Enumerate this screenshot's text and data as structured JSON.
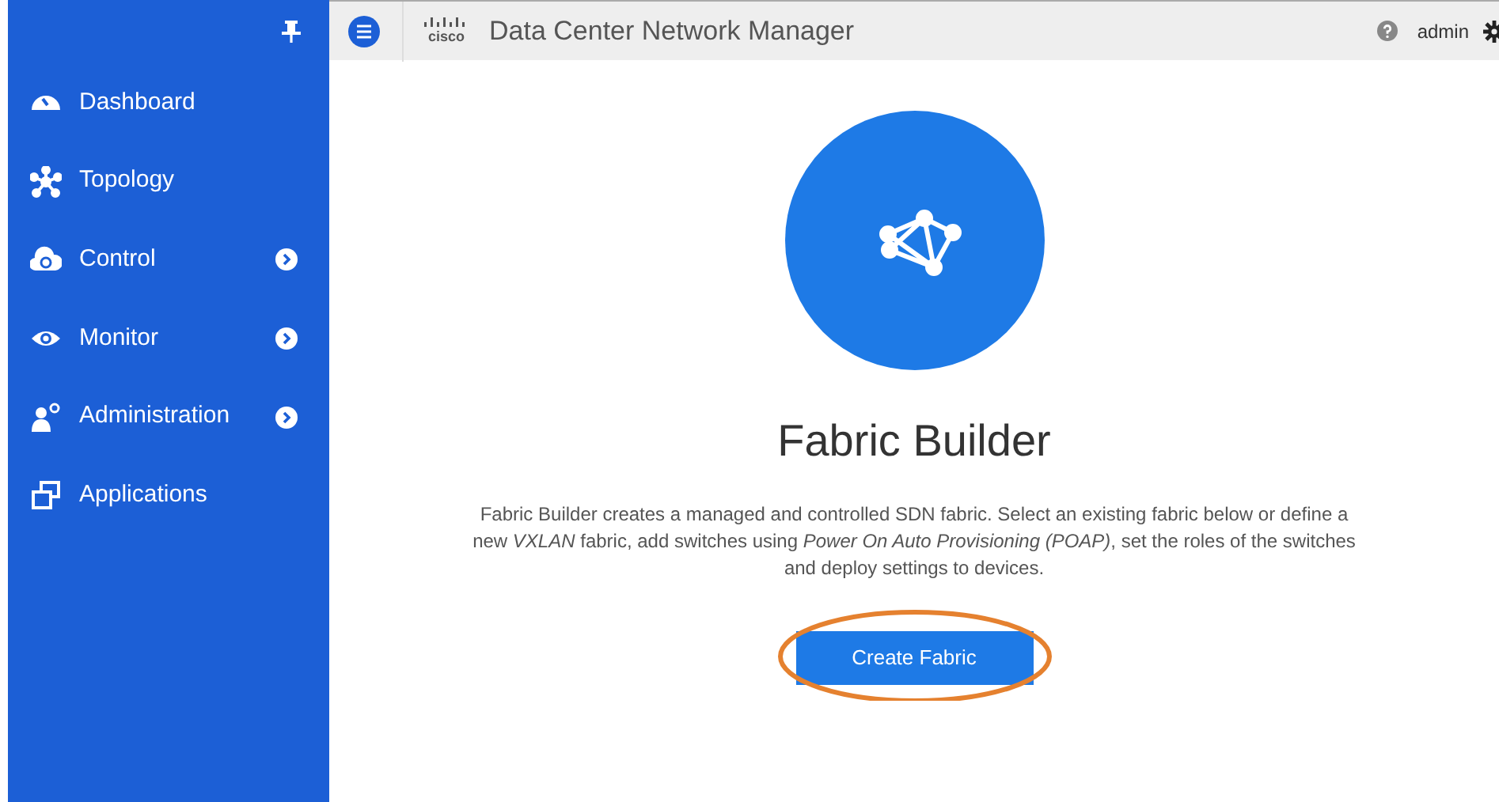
{
  "header": {
    "logo_text": "cisco",
    "title": "Data Center Network Manager",
    "user": "admin"
  },
  "sidebar": {
    "items": [
      {
        "kind": "dashboard",
        "label": "Dashboard",
        "has_submenu": false
      },
      {
        "kind": "topology",
        "label": "Topology",
        "has_submenu": false
      },
      {
        "kind": "control",
        "label": "Control",
        "has_submenu": true
      },
      {
        "kind": "monitor",
        "label": "Monitor",
        "has_submenu": true
      },
      {
        "kind": "administration",
        "label": "Administration",
        "has_submenu": true
      },
      {
        "kind": "applications",
        "label": "Applications",
        "has_submenu": false
      }
    ]
  },
  "main": {
    "title": "Fabric Builder",
    "description": "Fabric Builder creates a managed and controlled SDN fabric. Select an existing fabric below or define a new *VXLAN* fabric, add switches using *Power On Auto Provisioning (POAP)*, set the roles of the switches and deploy settings to devices.",
    "button": "Create Fabric",
    "button_highlighted": true
  }
}
